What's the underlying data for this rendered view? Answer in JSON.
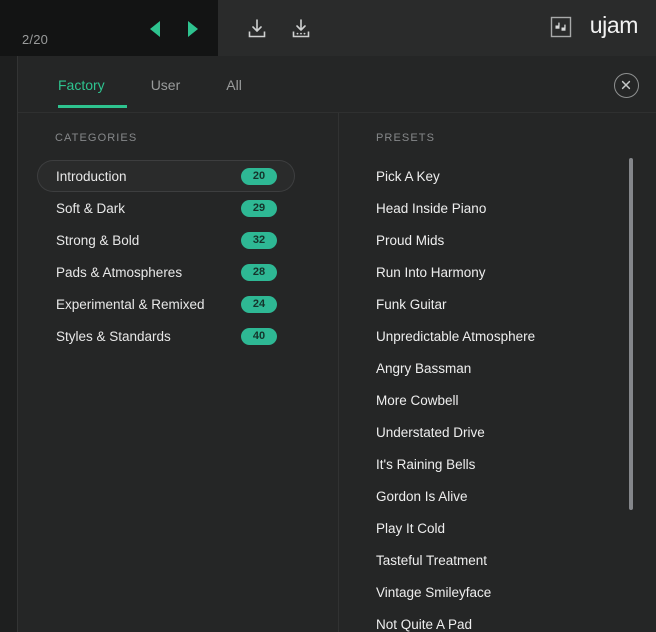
{
  "topbar": {
    "page_counter": "2/20",
    "prev_label": "Previous preset",
    "next_label": "Next preset",
    "download_label": "Download",
    "download_alt_label": "Download options",
    "midi_icon_label": "MIDI",
    "brand": "ujam",
    "accent_color": "#2ec38f",
    "dark_panel_color": "#131414"
  },
  "tabs": [
    {
      "label": "Factory",
      "active": true
    },
    {
      "label": "User",
      "active": false
    },
    {
      "label": "All",
      "active": false
    }
  ],
  "close_button": {
    "label": "Close browser"
  },
  "categories": {
    "heading": "CATEGORIES",
    "items": [
      {
        "name": "Introduction",
        "count": "20",
        "selected": true
      },
      {
        "name": "Soft & Dark",
        "count": "29",
        "selected": false
      },
      {
        "name": "Strong & Bold",
        "count": "32",
        "selected": false
      },
      {
        "name": "Pads & Atmospheres",
        "count": "28",
        "selected": false
      },
      {
        "name": "Experimental & Remixed",
        "count": "24",
        "selected": false
      },
      {
        "name": "Styles & Standards",
        "count": "40",
        "selected": false
      }
    ],
    "badge_color": "#2eb894"
  },
  "presets": {
    "heading": "PRESETS",
    "items": [
      {
        "name": "Pick A Key"
      },
      {
        "name": "Head Inside Piano"
      },
      {
        "name": "Proud Mids"
      },
      {
        "name": "Run Into Harmony"
      },
      {
        "name": "Funk Guitar"
      },
      {
        "name": "Unpredictable Atmosphere"
      },
      {
        "name": "Angry Bassman"
      },
      {
        "name": "More Cowbell"
      },
      {
        "name": "Understated Drive"
      },
      {
        "name": "It's Raining Bells"
      },
      {
        "name": "Gordon Is Alive"
      },
      {
        "name": "Play It Cold"
      },
      {
        "name": "Tasteful Treatment"
      },
      {
        "name": "Vintage Smileyface"
      },
      {
        "name": "Not Quite A Pad"
      }
    ]
  },
  "scrollbar": {
    "thumb_color": "#84868a"
  }
}
